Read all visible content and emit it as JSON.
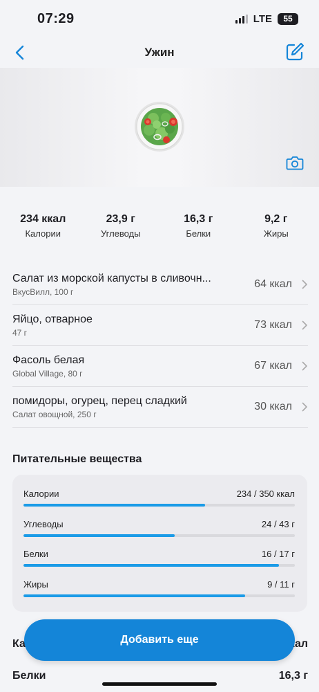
{
  "status": {
    "time": "07:29",
    "network": "LTE",
    "battery": "55"
  },
  "nav": {
    "title": "Ужин",
    "back_icon": "chevron-left-icon",
    "edit_icon": "edit-icon"
  },
  "photo": {
    "food_icon": "salad-plate-icon",
    "camera_icon": "camera-icon"
  },
  "macros": [
    {
      "value": "234 ккал",
      "label": "Калории"
    },
    {
      "value": "23,9 г",
      "label": "Углеводы"
    },
    {
      "value": "16,3 г",
      "label": "Белки"
    },
    {
      "value": "9,2 г",
      "label": "Жиры"
    }
  ],
  "foods": [
    {
      "name": "Салат из морской капусты в сливочн...",
      "sub": "ВкусВилл, 100 г",
      "kcal": "64 ккал"
    },
    {
      "name": "Яйцо, отварное",
      "sub": "47 г",
      "kcal": "73 ккал"
    },
    {
      "name": "Фасоль белая",
      "sub": "Global Village, 80 г",
      "kcal": "67 ккал"
    },
    {
      "name": "помидоры, огурец, перец сладкий",
      "sub": "Салат  овощной, 250 г",
      "kcal": "30 ккал"
    }
  ],
  "nutrients": {
    "title": "Питательные вещества",
    "items": [
      {
        "label": "Калории",
        "value": "234 / 350 ккал",
        "fraction": 0.669
      },
      {
        "label": "Углеводы",
        "value": "24 / 43 г",
        "fraction": 0.558
      },
      {
        "label": "Белки",
        "value": "16 / 17 г",
        "fraction": 0.941
      },
      {
        "label": "Жиры",
        "value": "9 / 11 г",
        "fraction": 0.818
      }
    ]
  },
  "summary": [
    {
      "label": "Калории",
      "value": "234 ккал"
    },
    {
      "label": "Белки",
      "value": "16,3 г"
    }
  ],
  "add_button": {
    "label": "Добавить еще"
  },
  "colors": {
    "accent": "#1485d8",
    "bar": "#1b9be7",
    "background": "#f3f4f7"
  }
}
